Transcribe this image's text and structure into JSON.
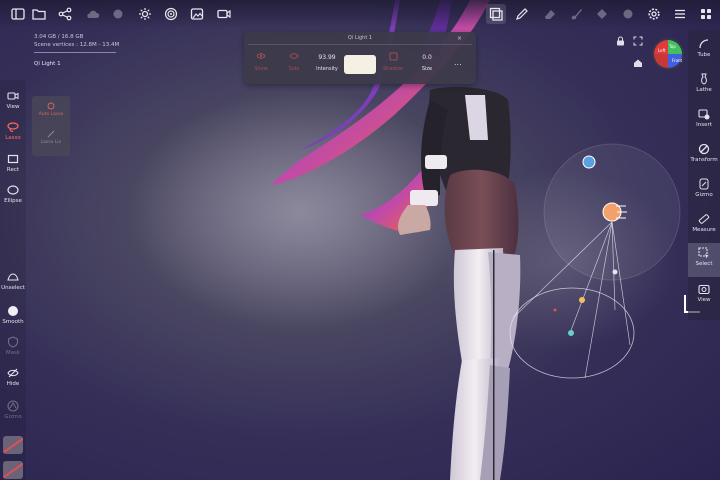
{
  "top_toolbar": {
    "left_icons": [
      "sidebar-icon",
      "folder-icon",
      "share-icon",
      "cloud-icon",
      "sculpt-icon",
      "sun-icon",
      "target-icon",
      "image-icon",
      "camera-icon"
    ],
    "right_icons": [
      "frame-icon",
      "pen-icon",
      "erase-icon",
      "brush-icon",
      "circle-icon",
      "gear-icon",
      "menu-icon",
      "grid-icon"
    ]
  },
  "memory": {
    "line1": "3.04 GB / 16.8 GB",
    "line2": "Scene vertices : 12.8M - 13.4M"
  },
  "scene_item": "Qi Light 1",
  "left_tools": [
    {
      "label": "View",
      "icon": "camera-icon"
    },
    {
      "label": "Lasso",
      "icon": "lasso-icon",
      "active": true
    },
    {
      "label": "Rect",
      "icon": "rect-icon"
    },
    {
      "label": "Ellipse",
      "icon": "ellipse-icon"
    },
    {
      "label": "Unselect",
      "icon": "unselect-icon"
    },
    {
      "label": "Smooth",
      "icon": "smooth-icon"
    },
    {
      "label": "Mask",
      "icon": "mask-icon",
      "dim": true
    },
    {
      "label": "Hide",
      "icon": "hide-icon"
    },
    {
      "label": "Gizmo",
      "icon": "gizmo-icon",
      "dim": true
    }
  ],
  "left_panel": {
    "item1": "Auto Lasso",
    "item2": "Lasso Lin"
  },
  "light_panel": {
    "title": "Qi Light 1",
    "close": "×",
    "show": "Show",
    "solo": "Solo",
    "intensity_value": "93.99",
    "intensity_label": "Intensity",
    "color_label": "",
    "shadow": "Shadow",
    "size_value": "0.0",
    "size_label": "Size",
    "more": "...",
    "color_hex": "#f4f0e3"
  },
  "right_tools": [
    {
      "label": "Tube",
      "icon": "tube-icon"
    },
    {
      "label": "Lathe",
      "icon": "lathe-icon"
    },
    {
      "label": "Insert",
      "icon": "insert-icon"
    },
    {
      "label": "Transform",
      "icon": "transform-icon"
    },
    {
      "label": "Gizmo",
      "icon": "gizmo-icon"
    },
    {
      "label": "Measure",
      "icon": "measure-icon"
    },
    {
      "label": "Select",
      "icon": "select-icon",
      "selected": true
    },
    {
      "label": "View",
      "icon": "camera-icon"
    }
  ],
  "nav_gizmo": {
    "labels": [
      "Left",
      "Top",
      "Front"
    ]
  },
  "colors": {
    "accent": "#ff6a5e",
    "light_color": "#f4f0e3",
    "gizmo_red": "#e03a3a",
    "gizmo_green": "#40c060",
    "gizmo_blue": "#4060e0"
  }
}
